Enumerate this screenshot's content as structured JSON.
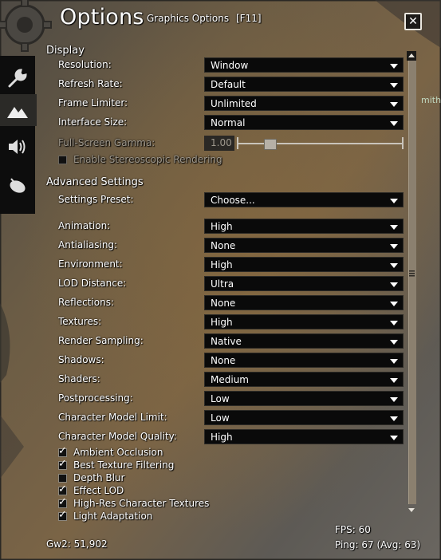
{
  "header": {
    "title": "Options",
    "subtitle": "Graphics Options",
    "hotkey": "[F11]",
    "close_glyph": "✕"
  },
  "tabs": [
    {
      "name": "general-tab",
      "icon": "wrench-icon"
    },
    {
      "name": "graphics-tab",
      "icon": "mountains-icon",
      "active": true
    },
    {
      "name": "audio-tab",
      "icon": "speaker-icon"
    },
    {
      "name": "controls-tab",
      "icon": "mouse-icon"
    }
  ],
  "display": {
    "heading": "Display",
    "resolution": {
      "label": "Resolution:",
      "value": "Window"
    },
    "refresh_rate": {
      "label": "Refresh Rate:",
      "value": "Default"
    },
    "frame_limiter": {
      "label": "Frame Limiter:",
      "value": "Unlimited"
    },
    "interface_size": {
      "label": "Interface Size:",
      "value": "Normal"
    },
    "gamma": {
      "label": "Full-Screen Gamma:",
      "value": "1.00",
      "slider_level": 0.2
    },
    "stereoscopic": {
      "label": "Enable Stereoscopic Rendering",
      "checked": false
    }
  },
  "advanced": {
    "heading": "Advanced Settings",
    "preset": {
      "label": "Settings Preset:",
      "value": "Choose..."
    },
    "animation": {
      "label": "Animation:",
      "value": "High"
    },
    "antialiasing": {
      "label": "Antialiasing:",
      "value": "None"
    },
    "environment": {
      "label": "Environment:",
      "value": "High"
    },
    "lod_distance": {
      "label": "LOD Distance:",
      "value": "Ultra"
    },
    "reflections": {
      "label": "Reflections:",
      "value": "None"
    },
    "textures": {
      "label": "Textures:",
      "value": "High"
    },
    "render_sampling": {
      "label": "Render Sampling:",
      "value": "Native"
    },
    "shadows": {
      "label": "Shadows:",
      "value": "None"
    },
    "shaders": {
      "label": "Shaders:",
      "value": "Medium"
    },
    "postprocessing": {
      "label": "Postprocessing:",
      "value": "Low"
    },
    "char_model_limit": {
      "label": "Character Model Limit:",
      "value": "Low"
    },
    "char_model_quality": {
      "label": "Character Model Quality:",
      "value": "High"
    },
    "ambient_occlusion": {
      "label": "Ambient Occlusion",
      "checked": true
    },
    "best_texture_filtering": {
      "label": "Best Texture Filtering",
      "checked": true
    },
    "depth_blur": {
      "label": "Depth Blur",
      "checked": false
    },
    "effect_lod": {
      "label": "Effect LOD",
      "checked": true
    },
    "high_res_textures": {
      "label": "High-Res Character Textures",
      "checked": true
    },
    "light_adaptation": {
      "label": "Light Adaptation",
      "checked": true
    },
    "check_glyph": "✓"
  },
  "footer": {
    "build": "Gw2: 51,902",
    "fps": "FPS: 60",
    "ping": "Ping: 67 (Avg: 63)"
  },
  "background_fragment": "mith",
  "colors": {
    "panel": "#5f584d",
    "dropdown_bg": "#0a0a0a",
    "text": "#f2efe8",
    "disabled_text": "#9d978c"
  }
}
